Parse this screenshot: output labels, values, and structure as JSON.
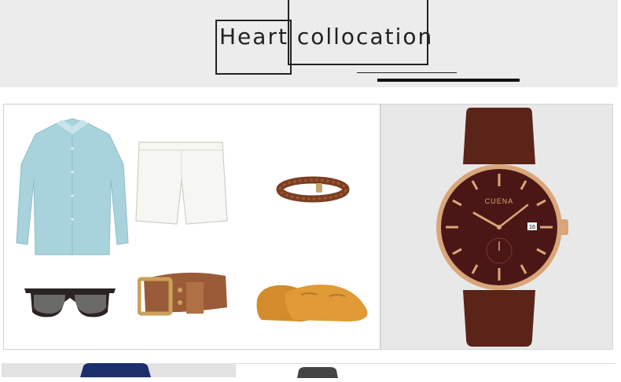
{
  "header": {
    "title_word1": "Heart",
    "title_word2": "collocation"
  },
  "outfit": {
    "items": [
      {
        "name": "light-blue-shirt"
      },
      {
        "name": "white-shorts"
      },
      {
        "name": "braided-leather-bracelet"
      },
      {
        "name": "sunglasses"
      },
      {
        "name": "brown-leather-belt"
      },
      {
        "name": "tan-suede-loafers"
      }
    ]
  },
  "watch": {
    "brand": "CUENA",
    "date": "16",
    "colors": {
      "dial": "#4a1616",
      "case": "#d9a67a",
      "strap": "#5a2418"
    }
  }
}
